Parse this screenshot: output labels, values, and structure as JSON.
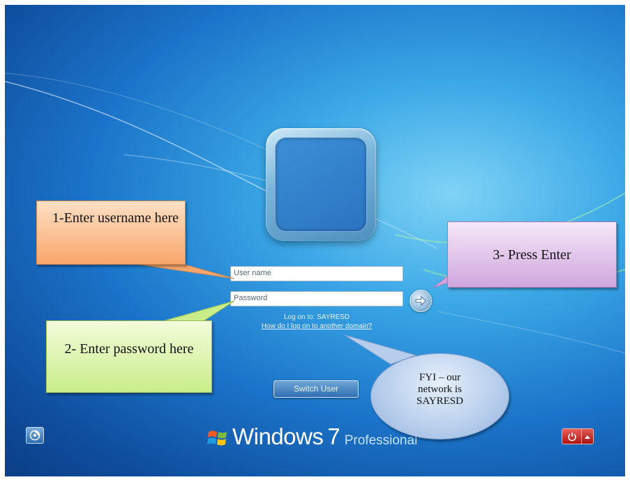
{
  "login": {
    "username_placeholder": "User name",
    "password_placeholder": "Password",
    "logon_to": "Log on to: SAYRESD",
    "logon_help": "How do I log on to another domain?",
    "switch_user": "Switch User"
  },
  "branding": {
    "name": "Windows",
    "version": "7",
    "edition": "Professional"
  },
  "callouts": {
    "username": "1-Enter username here",
    "password": "2- Enter password here",
    "enter": "3- Press Enter",
    "fyi": "FYI – our network is SAYRESD"
  },
  "icons": {
    "go": "arrow-right-icon",
    "ease_of_access": "ease-of-access-icon",
    "power": "power-icon",
    "power_options": "triangle-up-icon",
    "windows_logo": "windows-logo-icon"
  },
  "colors": {
    "background": "#1b74c9",
    "power_button": "#c8211b",
    "callout_orange": "#f9a66c",
    "callout_green": "#c9ed88",
    "callout_purple": "#cfa6dd",
    "callout_blue": "#b6cdeb"
  }
}
